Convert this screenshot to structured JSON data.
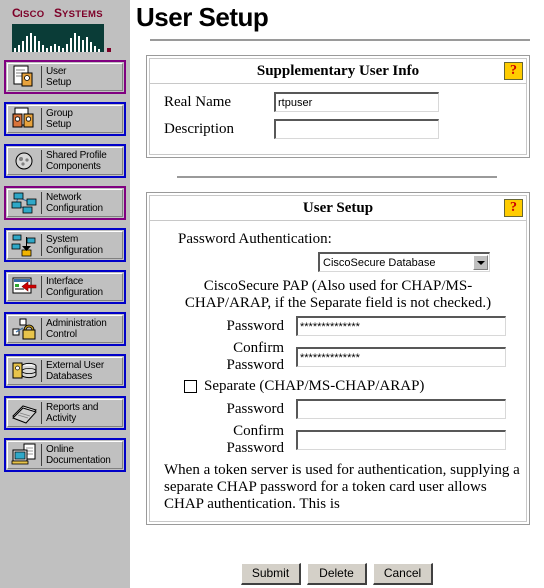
{
  "brand": {
    "name_part1": "C",
    "name": "CISCO SYSTEMS",
    "logo_color": "#7d0028"
  },
  "sidebar": {
    "items": [
      {
        "label_line1": "User",
        "label_line2": "Setup",
        "icon": "user-setup-icon",
        "visited": true
      },
      {
        "label_line1": "Group",
        "label_line2": "Setup",
        "icon": "group-setup-icon",
        "visited": false
      },
      {
        "label_line1": "Shared Profile",
        "label_line2": "Components",
        "icon": "shared-profile-icon",
        "visited": false
      },
      {
        "label_line1": "Network",
        "label_line2": "Configuration",
        "icon": "network-configuration-icon",
        "visited": true
      },
      {
        "label_line1": "System",
        "label_line2": "Configuration",
        "icon": "system-configuration-icon",
        "visited": false
      },
      {
        "label_line1": "Interface",
        "label_line2": "Configuration",
        "icon": "interface-configuration-icon",
        "visited": false
      },
      {
        "label_line1": "Administration",
        "label_line2": "Control",
        "icon": "administration-control-icon",
        "visited": false
      },
      {
        "label_line1": "External User",
        "label_line2": "Databases",
        "icon": "external-user-databases-icon",
        "visited": false
      },
      {
        "label_line1": "Reports and",
        "label_line2": "Activity",
        "icon": "reports-activity-icon",
        "visited": false
      },
      {
        "label_line1": "Online",
        "label_line2": "Documentation",
        "icon": "online-documentation-icon",
        "visited": false
      }
    ]
  },
  "page": {
    "title": "User Setup"
  },
  "supplementary_panel": {
    "title": "Supplementary User Info",
    "help_glyph": "?",
    "real_name_label": "Real Name",
    "real_name_value": "rtpuser",
    "description_label": "Description",
    "description_value": ""
  },
  "user_setup_panel": {
    "title": "User Setup",
    "help_glyph": "?",
    "password_auth_label": "Password Authentication:",
    "auth_selected": "CiscoSecure Database",
    "auth_options": [
      "CiscoSecure Database"
    ],
    "pap_note": "CiscoSecure PAP (Also used for CHAP/MS-CHAP/ARAP, if the Separate field is not checked.)",
    "password_label": "Password",
    "password_value": "**************",
    "confirm_label_line1": "Confirm",
    "confirm_label_line2": "Password",
    "confirm_value": "**************",
    "separate_label": "Separate (CHAP/MS-CHAP/ARAP)",
    "separate_checked": false,
    "sep_password_label": "Password",
    "sep_password_value": "",
    "sep_confirm_label_line1": "Confirm",
    "sep_confirm_label_line2": "Password",
    "sep_confirm_value": "",
    "token_note": "When a token server is used for authentication, supplying a separate CHAP password for a token card user allows CHAP authentication. This is"
  },
  "buttonbar": {
    "submit": "Submit",
    "delete": "Delete",
    "cancel": "Cancel"
  }
}
